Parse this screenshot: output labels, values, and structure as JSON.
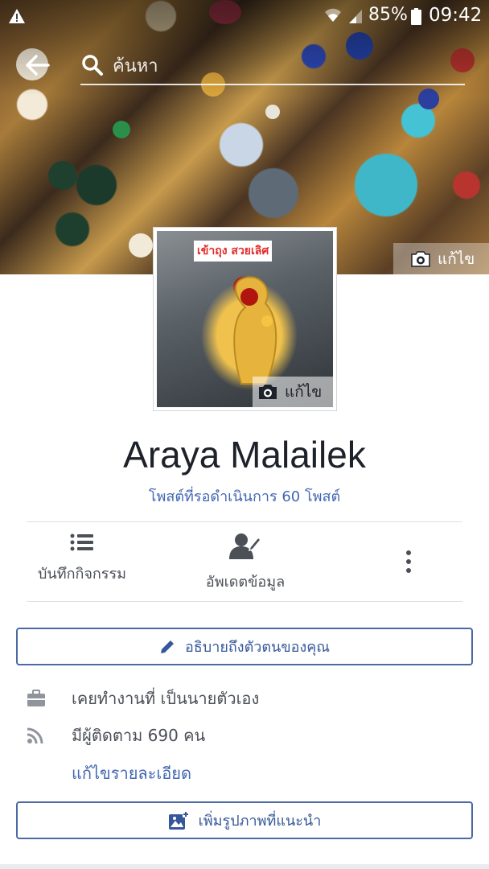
{
  "status_bar": {
    "battery": "85%",
    "time": "09:42"
  },
  "search": {
    "placeholder": "ค้นหา"
  },
  "cover": {
    "edit_label": "แก้ไข"
  },
  "profile": {
    "photo_caption": "เข้าถุง สวยเลิศ",
    "edit_label": "แก้ไข",
    "name": "Araya Malailek",
    "pending_posts": "โพสต์ที่รอดำเนินการ 60 โพสต์"
  },
  "actions": {
    "activity_log": "บันทึกกิจกรรม",
    "update_info": "อัพเดตข้อมูล"
  },
  "describe_button": "อธิบายถึงตัวตนของคุณ",
  "intro": {
    "work": "เคยทำงานที่ เป็นนายตัวเอง",
    "followers": "มีผู้ติดตาม 690 คน",
    "edit_details": "แก้ไขรายละเอียด"
  },
  "featured_photos_button": "เพิ่มรูปภาพที่แนะนำ",
  "colors": {
    "link": "#4267b2",
    "button_border": "#4b6aa5",
    "text": "#1d2129",
    "muted": "#4b4f56"
  }
}
